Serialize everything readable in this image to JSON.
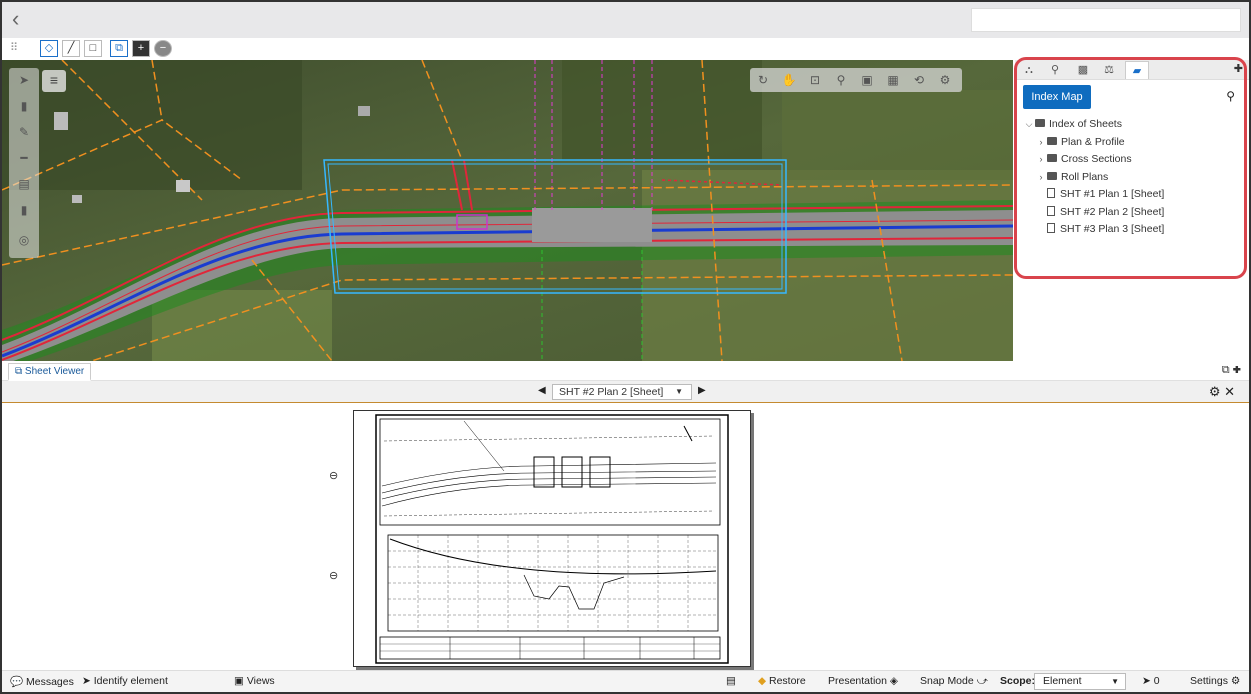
{
  "titlebar": {
    "back_icon": "chevron-left-icon",
    "search_value": ""
  },
  "right_panel": {
    "index_map_label": "Index Map",
    "tree": {
      "root": "Index of Sheets",
      "folders": [
        "Plan & Profile",
        "Cross Sections",
        "Roll Plans"
      ],
      "sheets": [
        "SHT #1 Plan 1 [Sheet]",
        "SHT #2 Plan 2 [Sheet]",
        "SHT #3 Plan 3 [Sheet]"
      ]
    }
  },
  "sheet_viewer": {
    "tab_label": "Sheet Viewer",
    "selected_sheet": "SHT #2 Plan 2 [Sheet]"
  },
  "statusbar": {
    "messages": "Messages",
    "identify": "Identify element",
    "views": "Views",
    "restore": "Restore",
    "presentation": "Presentation",
    "snap_mode": "Snap Mode",
    "scope_label": "Scope:",
    "scope_value": "Element",
    "selection_count": "0",
    "settings": "Settings"
  },
  "colors": {
    "accent": "#0f6cbf",
    "highlight": "#d9444c",
    "road_red": "#e0263a",
    "road_blue": "#1a3cd0",
    "boundary_cyan": "#36b8ff"
  }
}
